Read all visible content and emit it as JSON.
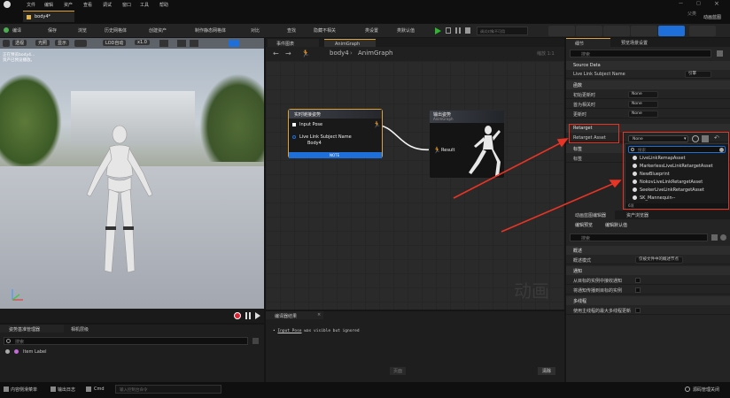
{
  "menubar": [
    "文件",
    "编辑",
    "资产",
    "查看",
    "调试",
    "窗口",
    "工具",
    "帮助"
  ],
  "tab": {
    "title": "body4*"
  },
  "window": {
    "right_a": "父类",
    "right_b": "动画蓝图"
  },
  "toolbar": {
    "compile": "编译",
    "save": "保存",
    "browse": "浏览",
    "history": "历史网格体",
    "create_asset": "创建资产",
    "make_static": "制作静态网格体",
    "diff": "对比",
    "find": "查找",
    "hide": "隐藏不相关",
    "class_settings": "类设置",
    "class_defaults": "类默认值",
    "debug_placeholder": "调试对象不可用"
  },
  "viewport": {
    "view_mode": "透视",
    "lit": "光照",
    "show": "显示",
    "lod": "LOD自动",
    "speed": "x1.0",
    "overlay_line1": "正在预览body4...",
    "overlay_line2": "资产已预览播放。"
  },
  "graph": {
    "tab_events": "事件图表",
    "tab_anim": "AnimGraph",
    "crumb_root": "body4",
    "crumb_leaf": "AnimGraph",
    "zoom": "缩放 1:1",
    "watermark": "动画",
    "node_livelink": {
      "title": "实时链接姿势",
      "pin_pose": "Input Pose",
      "pin_subject": "Live Link Subject Name",
      "subject_value": "Body4",
      "footer": "NOTE"
    },
    "node_output": {
      "title": "输出姿势",
      "subtitle": "AnimGraph",
      "pin_result": "Result"
    }
  },
  "compiler": {
    "tab": "编译器结果",
    "msg_pin": "Input Pose",
    "msg_rest": " was visible but ignored",
    "page_btn": "页面",
    "clear_btn": "清除"
  },
  "details": {
    "tab_details": "细节",
    "tab_preview": "预览场景设置",
    "search_placeholder": "搜索",
    "sec_source": "Source Data",
    "subject_label": "Live Link Subject Name",
    "subject_value": "引擎",
    "sec_functions": "函数",
    "fn1_label": "初始更新时",
    "fn2_label": "首为相关时",
    "fn3_label": "更新时",
    "fn_value": "None",
    "sec_retarget": "Retarget",
    "retarget_label": "Retarget Asset",
    "retarget_value": "None",
    "sec_tags": "标签",
    "tag_label": "标签",
    "popup_search": "搜索",
    "options": [
      "LiveLinkRemapAsset",
      "MarkerlessLiveLinkRetargetAsset",
      "NewBlueprint",
      "NokovLiveLinkRetargetAsset",
      "SeekerLiveLinkRetargetAsset",
      "SK_Mannequin--"
    ],
    "popup_footer": "6项"
  },
  "asset": {
    "tab_editor": "动画蓝图编辑器",
    "tab_browser": "资产浏览器",
    "tab_preview_settings": "编辑预览",
    "tab_defaults": "编辑默认值",
    "search_placeholder": "搜索",
    "sec_overview": "概述",
    "mode_label": "概述模式",
    "mode_value": "仅被文件中的概述节点",
    "sec_notify": "通知",
    "notify1": "从目标的实例中接收通知",
    "notify2": "将通知传播到目标的实例",
    "sec_thread": "多线程",
    "thread1": "使用主线程的最大多线程更新"
  },
  "bottom": {
    "tab_assets": "姿势基准管理器",
    "tab_layers": "相机层级",
    "search_placeholder": "搜索",
    "item": "Item Label"
  },
  "status": {
    "content": "内容侧滑菜单",
    "output": "输出日志",
    "cmd": "Cmd",
    "cmd_placeholder": "输入控制台命令",
    "source": "源码管理关闭"
  },
  "colors": {
    "accent": "#d9a23a",
    "annot": "#e83424",
    "link": "#1e6fd9",
    "play": "#2fb52f"
  }
}
